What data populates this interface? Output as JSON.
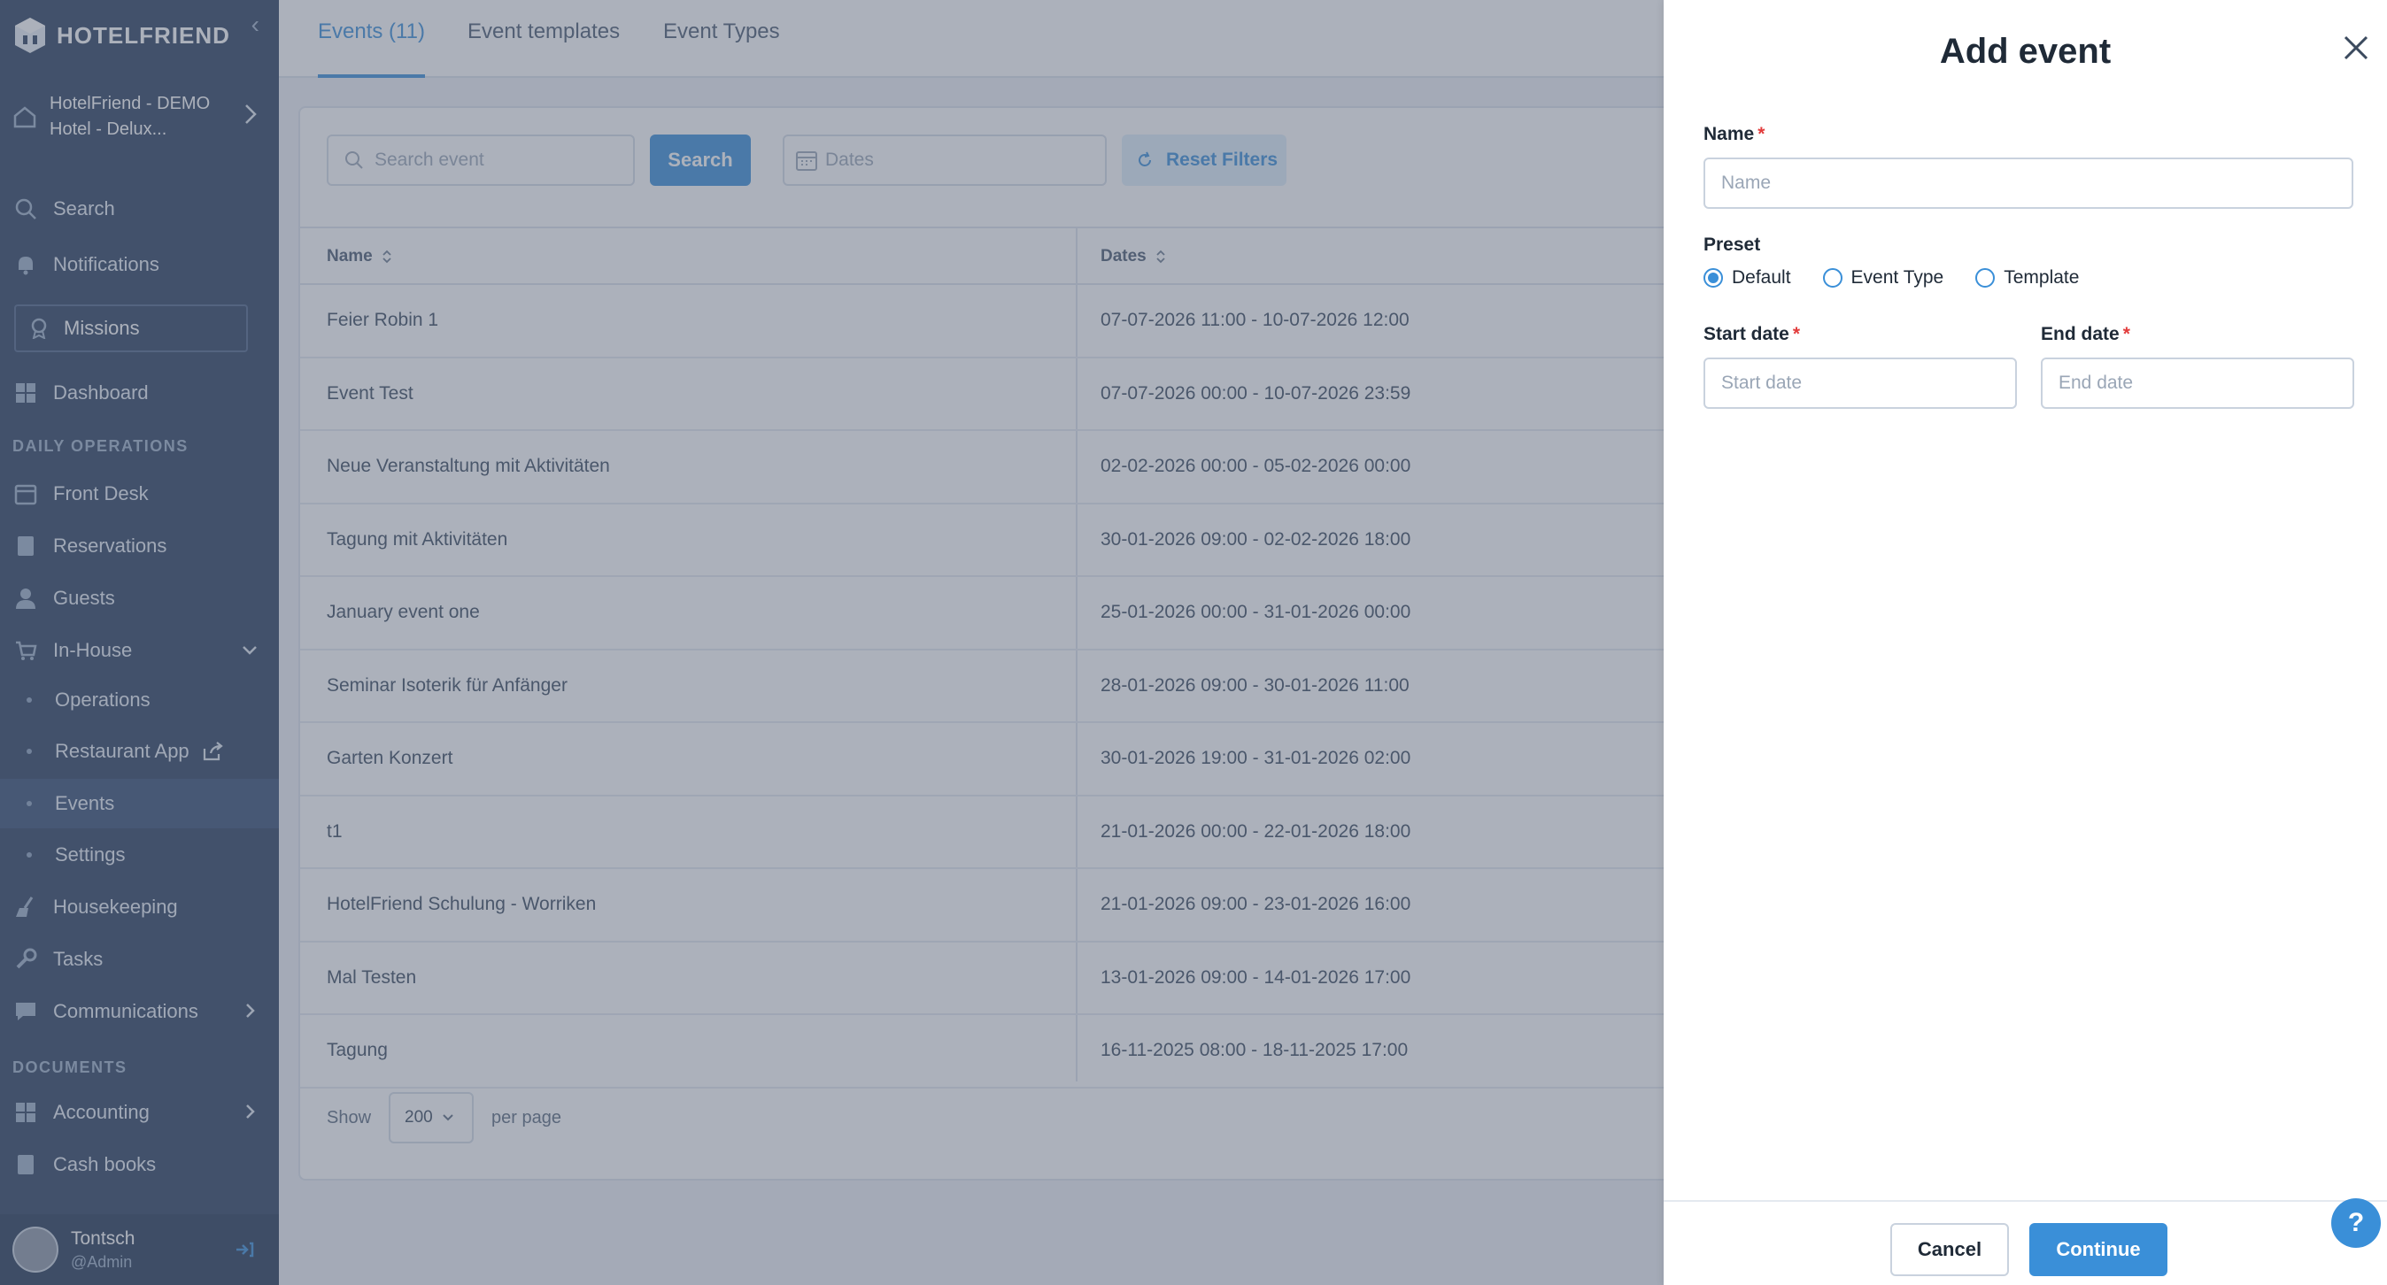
{
  "brand": {
    "logo_text": "HOTELFRIEND",
    "accent": "#3a8fd8"
  },
  "sidebar": {
    "collapse_symbol": "‹",
    "hotel_name": "HotelFriend - DEMO Hotel - Delux...",
    "search": "Search",
    "notifications": "Notifications",
    "missions": "Missions",
    "dashboard": "Dashboard",
    "section_daily": "DAILY OPERATIONS",
    "front_desk": "Front Desk",
    "reservations": "Reservations",
    "guests": "Guests",
    "in_house": "In-House",
    "operations": "Operations",
    "restaurant_app": "Restaurant App",
    "events": "Events",
    "settings": "Settings",
    "housekeeping": "Housekeeping",
    "tasks": "Tasks",
    "communications": "Communications",
    "section_documents": "DOCUMENTS",
    "accounting": "Accounting",
    "cash_books": "Cash books",
    "user_name": "Tontsch",
    "user_role": "@Admin"
  },
  "tabs": [
    "Events (11)",
    "Event templates",
    "Event Types"
  ],
  "toolbar": {
    "search_placeholder": "Search event",
    "search_button": "Search",
    "dates_placeholder": "Dates",
    "reset_filters": "Reset Filters"
  },
  "table": {
    "columns": [
      "Name",
      "Dates"
    ],
    "rows": [
      {
        "name": "Feier Robin 1",
        "dates": "07-07-2026 11:00 - 10-07-2026 12:00"
      },
      {
        "name": "Event Test",
        "dates": "07-07-2026 00:00 - 10-07-2026 23:59"
      },
      {
        "name": "Neue Veranstaltung mit Aktivitäten",
        "dates": "02-02-2026 00:00 - 05-02-2026 00:00"
      },
      {
        "name": "Tagung mit Aktivitäten",
        "dates": "30-01-2026 09:00 - 02-02-2026 18:00"
      },
      {
        "name": "January event one",
        "dates": "25-01-2026 00:00 - 31-01-2026 00:00"
      },
      {
        "name": "Seminar Isoterik für Anfänger",
        "dates": "28-01-2026 09:00 - 30-01-2026 11:00"
      },
      {
        "name": "Garten Konzert",
        "dates": "30-01-2026 19:00 - 31-01-2026 02:00"
      },
      {
        "name": "t1",
        "dates": "21-01-2026 00:00 - 22-01-2026 18:00"
      },
      {
        "name": "HotelFriend Schulung - Worriken",
        "dates": "21-01-2026 09:00 - 23-01-2026 16:00"
      },
      {
        "name": "Mal Testen",
        "dates": "13-01-2026 09:00 - 14-01-2026 17:00"
      },
      {
        "name": "Tagung",
        "dates": "16-11-2025 08:00 - 18-11-2025 17:00"
      }
    ]
  },
  "pagination": {
    "show_label": "Show",
    "per_page_value": "200",
    "per_page_label": "per page"
  },
  "drawer": {
    "title": "Add event",
    "name_label": "Name",
    "name_placeholder": "Name",
    "required_mark": "*",
    "preset_label": "Preset",
    "preset_options": [
      "Default",
      "Event Type",
      "Template"
    ],
    "preset_selected": "Default",
    "start_label": "Start date",
    "start_placeholder": "Start date",
    "end_label": "End date",
    "end_placeholder": "End date",
    "cancel": "Cancel",
    "continue": "Continue",
    "help": "?"
  }
}
